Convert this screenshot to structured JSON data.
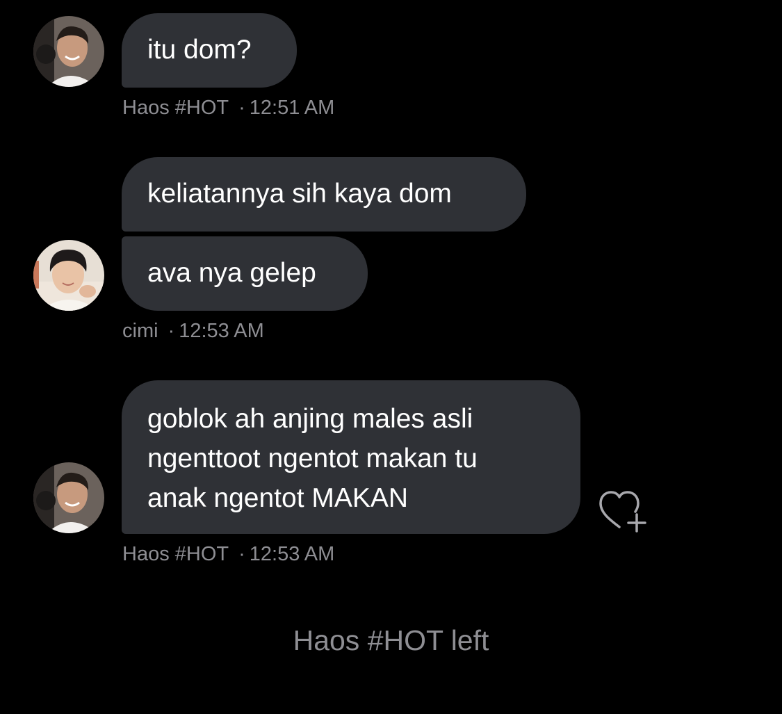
{
  "messages": [
    {
      "sender": "Haos #HOT",
      "time": "12:51 AM",
      "text": "itu dom?"
    },
    {
      "sender": "cimi",
      "time": "12:53 AM",
      "texts": [
        "keliatannya sih kaya dom",
        "ava nya gelep"
      ]
    },
    {
      "sender": "Haos #HOT",
      "time": "12:53 AM",
      "lines": [
        "goblok ah anjing males asli",
        "ngenttoot ngentot makan tu",
        "anak ngentot MAKAN"
      ]
    }
  ],
  "separator": "·",
  "system_notice": "Haos #HOT left",
  "icons": {
    "react": "heart-plus-icon",
    "avatar_haos": "avatar-haos",
    "avatar_cimi": "avatar-cimi"
  },
  "colors": {
    "background": "#000000",
    "bubble": "#2f3136",
    "meta_text": "#8e8e93"
  }
}
